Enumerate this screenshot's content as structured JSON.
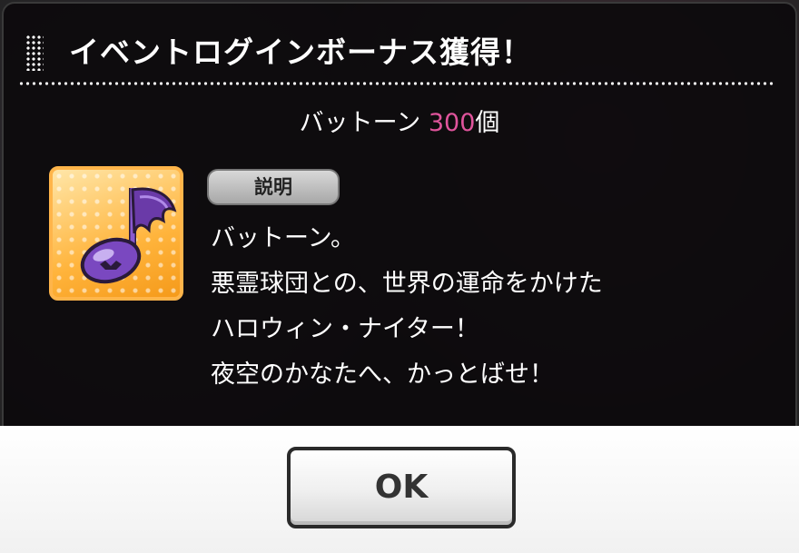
{
  "dialog": {
    "title": "イベントログインボーナス獲得！"
  },
  "reward": {
    "item_name": "バットーン",
    "quantity": "300",
    "unit": "個",
    "quantity_color": "#e0549c"
  },
  "description": {
    "badge_label": "説明",
    "lines": [
      "バットーン。",
      "悪霊球団との、世界の運命をかけた",
      "ハロウィン・ナイター！",
      "夜空のかなたへ、かっとばせ！"
    ]
  },
  "item_icon": {
    "icon": "bat-winged-music-note-icon"
  },
  "buttons": {
    "ok_label": "OK"
  }
}
